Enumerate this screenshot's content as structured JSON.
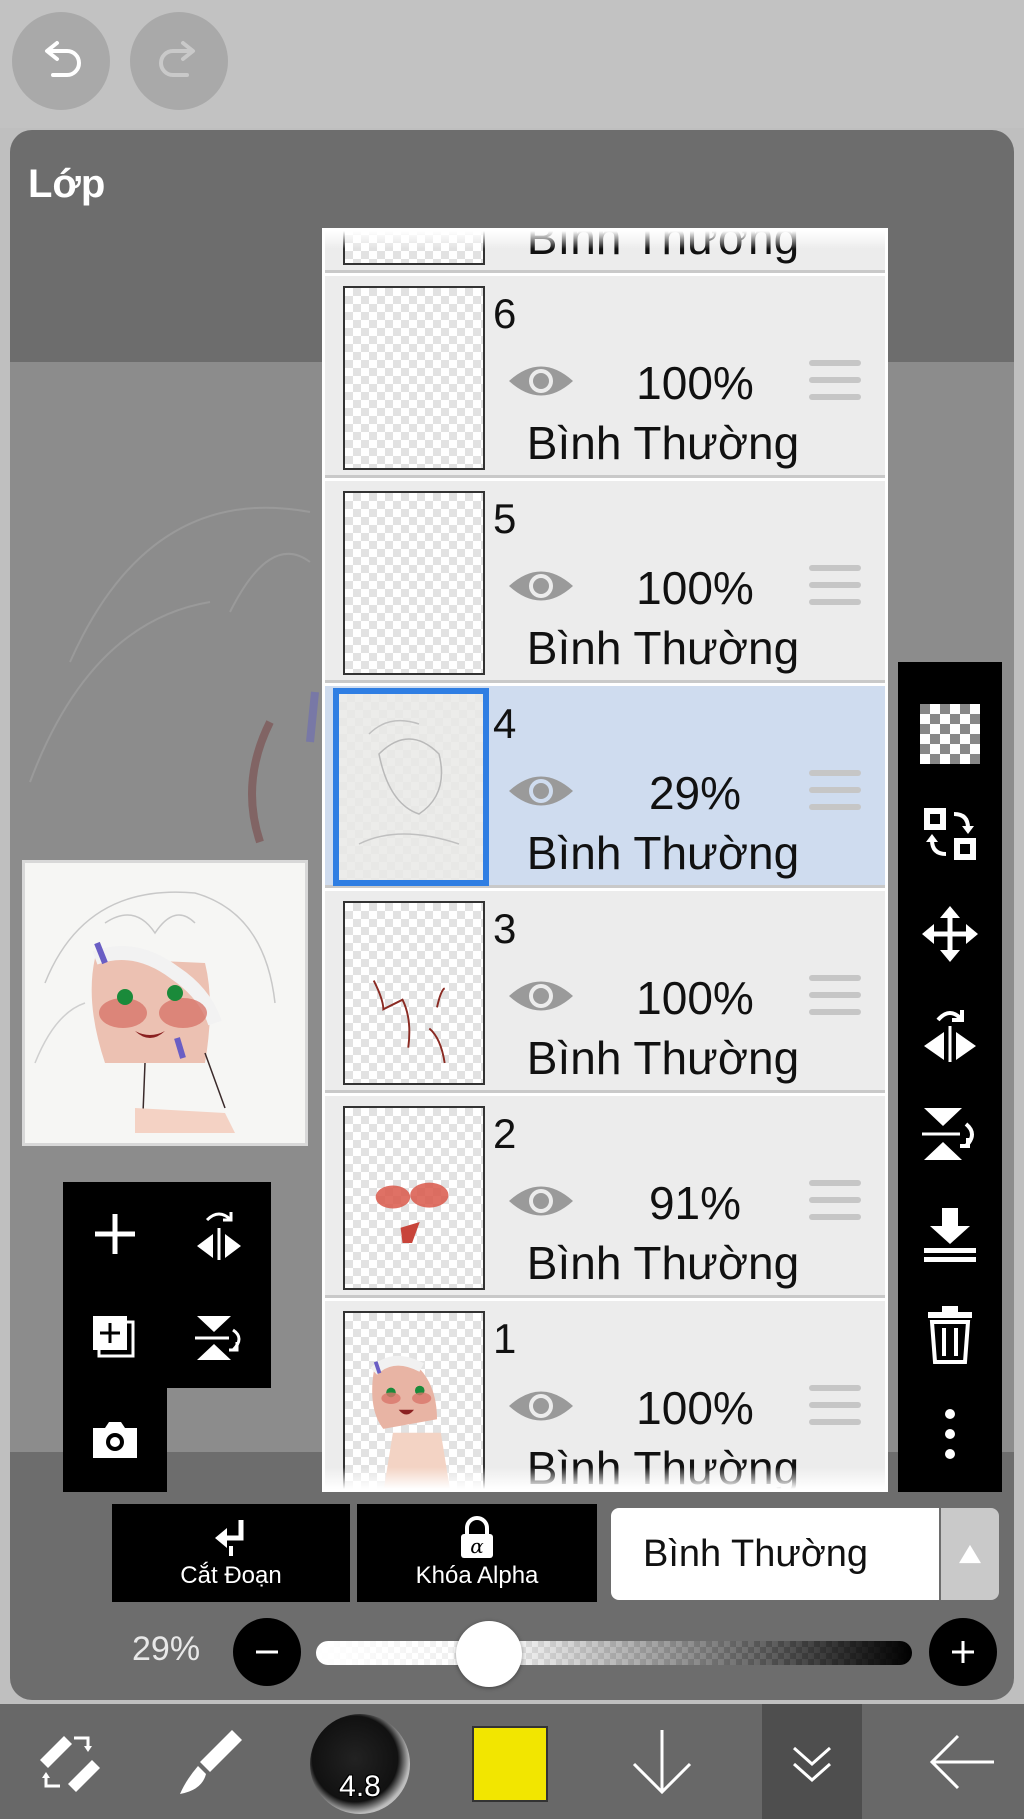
{
  "panel": {
    "title": "Lớp"
  },
  "layers": [
    {
      "number": "",
      "opacity": "",
      "blend": "Bình Thường",
      "selected": false
    },
    {
      "number": "6",
      "opacity": "100%",
      "blend": "Bình Thường",
      "selected": false
    },
    {
      "number": "5",
      "opacity": "100%",
      "blend": "Bình Thường",
      "selected": false
    },
    {
      "number": "4",
      "opacity": "29%",
      "blend": "Bình Thường",
      "selected": true
    },
    {
      "number": "3",
      "opacity": "100%",
      "blend": "Bình Thường",
      "selected": false
    },
    {
      "number": "2",
      "opacity": "91%",
      "blend": "Bình Thường",
      "selected": false
    },
    {
      "number": "1",
      "opacity": "100%",
      "blend": "Bình Thường",
      "selected": false
    }
  ],
  "actions": {
    "clip_label": "Cắt Đoạn",
    "alpha_lock_label": "Khóa Alpha",
    "alpha_glyph": "α",
    "blend_mode": "Bình Thường"
  },
  "opacity_slider": {
    "label": "29%",
    "value": 0.29
  },
  "brush": {
    "size": "4.8"
  },
  "colors": {
    "selected_layer": "#cfdcef",
    "selected_border": "#2f7ee3",
    "current_color": "#f2e600"
  },
  "icons": {
    "top": [
      "undo-icon",
      "redo-icon"
    ],
    "left_tools": [
      "add-layer-icon",
      "flip-horizontal-icon",
      "add-layer-copy-icon",
      "flip-vertical-icon",
      "camera-icon"
    ],
    "right_tools": [
      "transparency-icon",
      "swap-layer-icon",
      "move-icon",
      "flip-horizontal-icon",
      "flip-vertical-icon",
      "merge-down-icon",
      "trash-icon",
      "more-icon"
    ],
    "bottom": [
      "transform-eraser-icon",
      "brush-icon",
      "brush-size-icon",
      "color-icon",
      "arrow-down-icon",
      "layers-collapse-icon",
      "back-icon"
    ]
  }
}
